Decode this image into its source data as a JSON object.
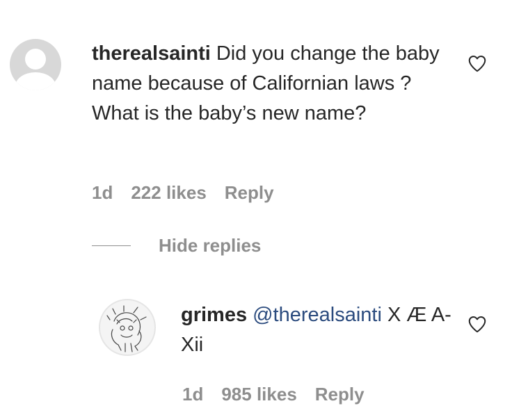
{
  "comment": {
    "username": "therealsainti",
    "text": "Did you change the baby name because of Californian laws ? What is the baby’s new name?",
    "time": "1d",
    "likes": "222 likes",
    "reply_label": "Reply"
  },
  "replies_toggle": {
    "label": "Hide replies"
  },
  "reply": {
    "username": "grimes",
    "mention": "@therealsainti",
    "text": "X Æ A-Xii",
    "time": "1d",
    "likes": "985 likes",
    "reply_label": "Reply"
  },
  "icons": {
    "like": "heart-outline-icon",
    "avatar_placeholder": "default-avatar-icon"
  },
  "colors": {
    "text": "#262626",
    "muted": "#8e8e8e",
    "mention": "#2b4b7e"
  }
}
